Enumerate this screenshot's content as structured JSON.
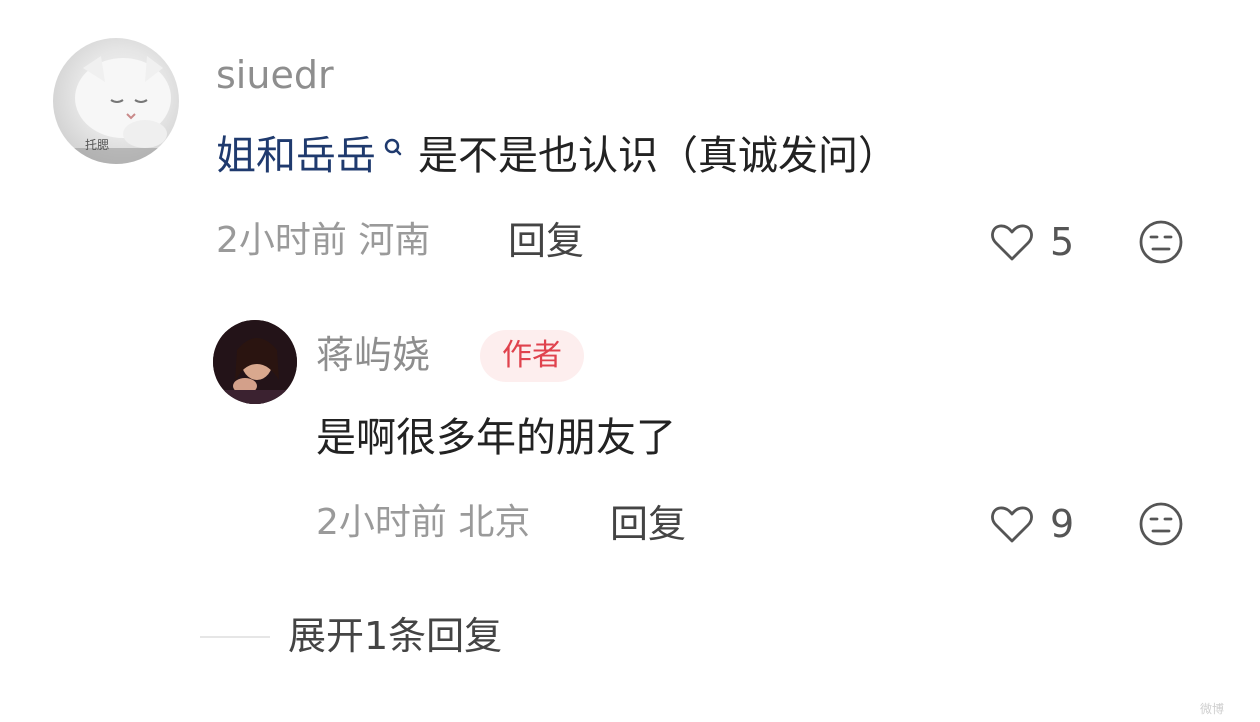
{
  "comment": {
    "avatar_icon": "cat-avatar-image",
    "avatar_caption": "托腮",
    "username": "siuedr",
    "mention": "姐和岳岳",
    "mention_icon": "search-icon",
    "text": "是不是也认识（真诚发问）",
    "time": "2小时前",
    "location": "河南",
    "reply_label": "回复",
    "like_icon": "heart-outline-icon",
    "like_count": "5",
    "dislike_icon": "meh-face-icon"
  },
  "reply": {
    "avatar_icon": "woman-avatar-image",
    "username": "蒋屿娆",
    "badge": "作者",
    "text": "是啊很多年的朋友了",
    "time": "2小时前",
    "location": "北京",
    "reply_label": "回复",
    "like_icon": "heart-outline-icon",
    "like_count": "9",
    "dislike_icon": "meh-face-icon"
  },
  "expand": {
    "label": "展开1条回复"
  },
  "watermark": {
    "text": "微博"
  },
  "colors": {
    "mention": "#1f3a6e",
    "badge_bg": "#fdeeee",
    "badge_text": "#e0424d"
  }
}
